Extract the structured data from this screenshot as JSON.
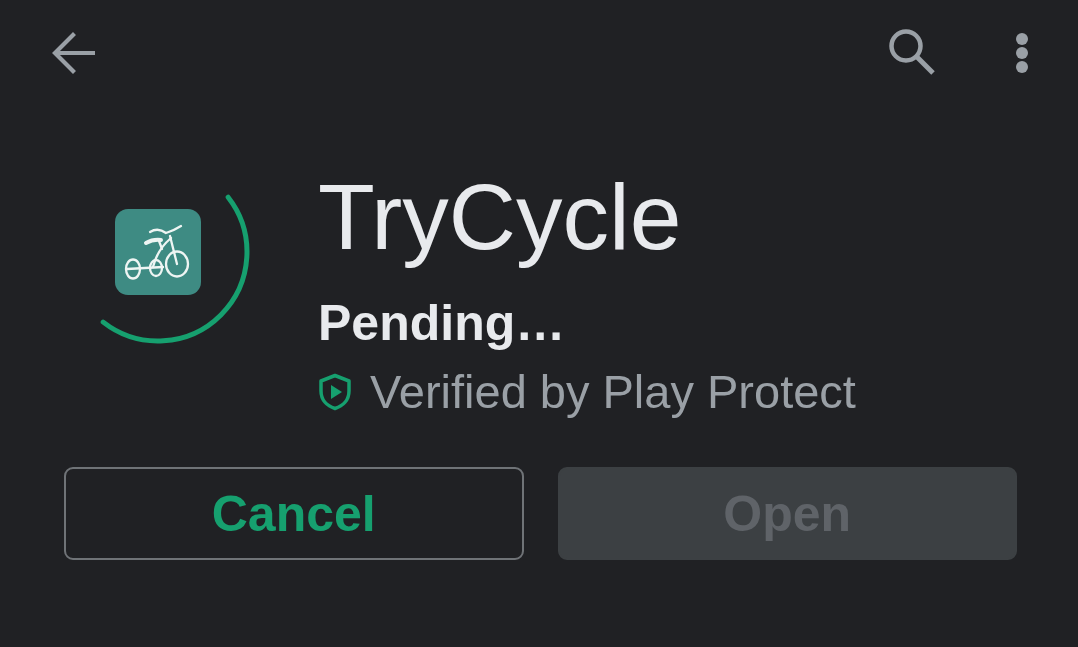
{
  "app": {
    "name": "TryCycle",
    "status": "Pending…",
    "verification": "Verified by Play Protect"
  },
  "buttons": [
    {
      "label": "Cancel",
      "kind": "outlined",
      "disabled": false
    },
    {
      "label": "Open",
      "kind": "filled",
      "disabled": true
    }
  ]
}
